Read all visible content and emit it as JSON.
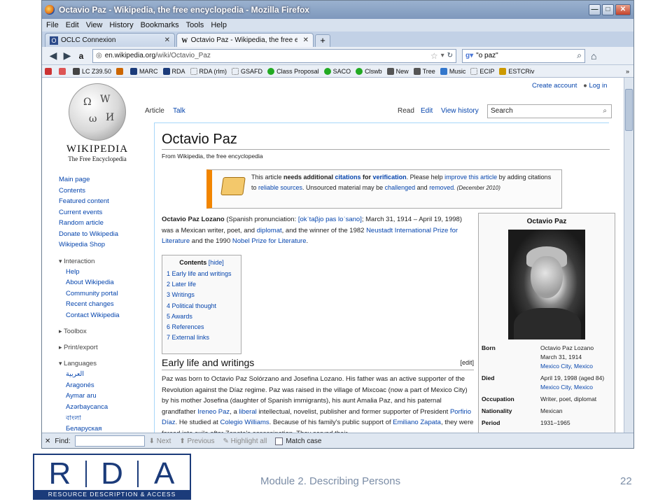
{
  "window": {
    "title": "Octavio Paz - Wikipedia, the free encyclopedia - Mozilla Firefox",
    "minimize": "—",
    "maximize": "□",
    "close": "✕"
  },
  "menubar": [
    "File",
    "Edit",
    "View",
    "History",
    "Bookmarks",
    "Tools",
    "Help"
  ],
  "tabs": [
    {
      "label": "OCLC Connexion",
      "active": false
    },
    {
      "label": "Octavio Paz - Wikipedia, the free encyclo...",
      "active": true
    }
  ],
  "newtab": "+",
  "navbar": {
    "url_host": "en.wikipedia.org",
    "url_path": "/wiki/Octavio_Paz",
    "search_value": "\"o paz\""
  },
  "bookmarks": [
    "LC Z39.50",
    "MARC",
    "RDA",
    "RDA (rlm)",
    "GSAFD",
    "Class Proposal",
    "SACO",
    "Clswb",
    "New",
    "Tree",
    "Music",
    "ECIP",
    "ESTCRiv"
  ],
  "wikipedia": {
    "logo_name": "Wikipedia",
    "logo_sub": "The Free Encyclopedia",
    "create_account": "Create account",
    "log_in": "Log in",
    "tabs": {
      "article": "Article",
      "talk": "Talk",
      "read": "Read",
      "edit": "Edit",
      "view_history": "View history"
    },
    "search_placeholder": "Search",
    "nav": [
      "Main page",
      "Contents",
      "Featured content",
      "Current events",
      "Random article",
      "Donate to Wikipedia",
      "Wikipedia Shop"
    ],
    "interaction_label": "Interaction",
    "interaction": [
      "Help",
      "About Wikipedia",
      "Community portal",
      "Recent changes",
      "Contact Wikipedia"
    ],
    "toolbox_label": "Toolbox",
    "printexport_label": "Print/export",
    "languages_label": "Languages",
    "languages": [
      "العربية",
      "Aragonés",
      "Aymar aru",
      "Azərbaycanca",
      "বাংলা",
      "Беларуская"
    ]
  },
  "article": {
    "title": "Octavio Paz",
    "from": "From Wikipedia, the free encyclopedia",
    "notice": {
      "t1": "This article ",
      "t2": "needs additional ",
      "t3": "citations",
      "t4": " for ",
      "t5": "verification",
      "t6": ". Please help ",
      "t7": "improve this article",
      "t8": " by adding citations to ",
      "t9": "reliable sources",
      "t10": ". Unsourced material may be ",
      "t11": "challenged",
      "t12": " and ",
      "t13": "removed",
      "t14": ". (December 2010)"
    },
    "lead": {
      "name": "Octavio Paz Lozano",
      "p1": " (Spanish pronunciation: ",
      "ipa": "[okˈtaβjo pas loˈsano]",
      "p2": "; March 31, 1914 – April 19, 1998) was a Mexican writer, poet, and ",
      "diplomat": "diplomat",
      "p3": ", and the winner of the 1982 ",
      "neustadt": "Neustadt International Prize for Literature",
      "p4": " and the 1990 ",
      "nobel": "Nobel Prize for Literature",
      "p5": "."
    },
    "toc": {
      "title": "Contents",
      "hide": "[hide]",
      "items": [
        "1 Early life and writings",
        "2 Later life",
        "3 Writings",
        "4 Political thought",
        "5 Awards",
        "6 References",
        "7 External links"
      ]
    },
    "section": {
      "title": "Early life and writings",
      "edit": "[edit]",
      "b1": "Paz was born to Octavio Paz Solórzano and Josefina Lozano. His father was an active supporter of the Revolution against the Díaz regime. Paz was raised in the village of Mixcoac (now a part of Mexico City) by his mother Josefina (daughter of Spanish immigrants), his aunt Amalia Paz, and his paternal grandfather ",
      "ireneo": "Ireneo Paz",
      "b2": ", a ",
      "liberal": "liberal",
      "b3": " intellectual, novelist, publisher and former supporter of President ",
      "porfirio": "Porfirio Díaz",
      "b4": ". He studied at ",
      "colegio": "Colegio Williams",
      "b5": ". Because of his family's public support of ",
      "zapata": "Emiliano Zapata",
      "b6": ", they were forced into exile after Zapata's assassination. They served their"
    },
    "infobox": {
      "title": "Octavio Paz",
      "rows": [
        {
          "label": "Born",
          "value": "Octavio Paz Lozano",
          "value2": "March 31, 1914",
          "value3": "Mexico City, Mexico"
        },
        {
          "label": "Died",
          "value": "April 19, 1998 (aged 84)",
          "value2": "Mexico City, Mexico"
        },
        {
          "label": "Occupation",
          "value": "Writer, poet, diplomat"
        },
        {
          "label": "Nationality",
          "value": "Mexican"
        },
        {
          "label": "Period",
          "value": "1931–1965"
        }
      ]
    }
  },
  "findbar": {
    "label": "Find:",
    "next": "Next",
    "previous": "Previous",
    "highlight_all": "Highlight all",
    "match_case": "Match case"
  },
  "slide": {
    "logo_letters": [
      "R",
      "D",
      "A"
    ],
    "logo_band": "RESOURCE DESCRIPTION & ACCESS",
    "footer_title": "Module 2. Describing Persons",
    "page_number": "22"
  }
}
